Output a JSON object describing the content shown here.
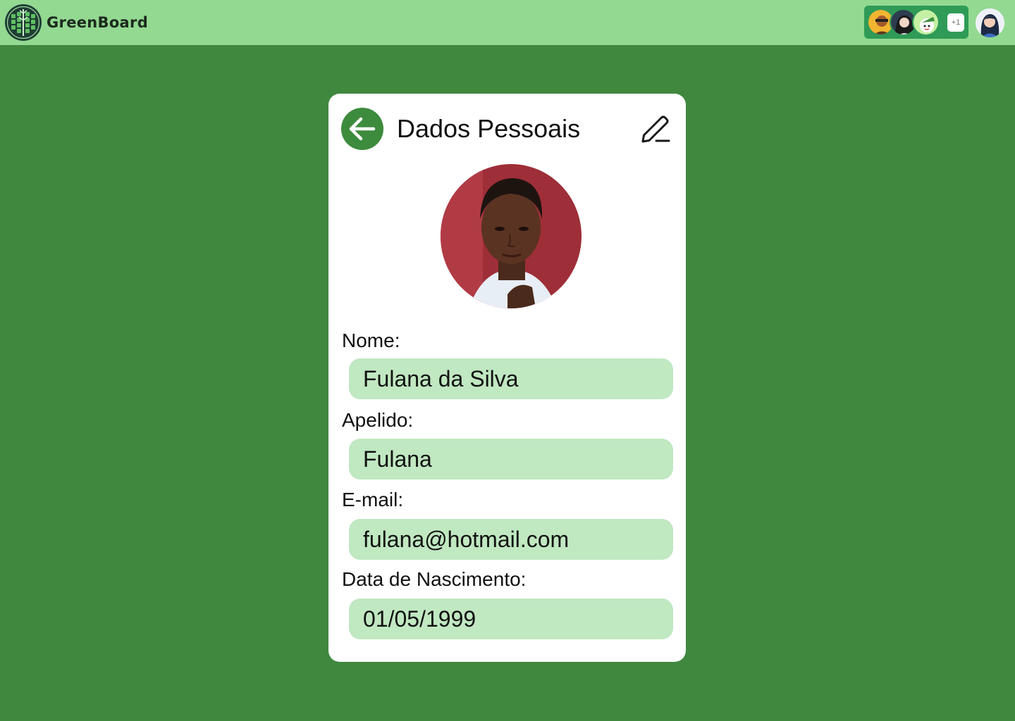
{
  "app": {
    "name": "GreenBoard",
    "logo_icon": "tree-grid-logo-icon"
  },
  "topbar": {
    "collaborators_more": "+1",
    "collaborator_icons": [
      "avatar-1",
      "avatar-2",
      "avatar-3"
    ],
    "user_icon": "user-avatar"
  },
  "card": {
    "title": "Dados Pessoais",
    "back_icon": "arrow-left-icon",
    "edit_icon": "pencil-icon"
  },
  "fields": {
    "name_label": "Nome:",
    "name_value": "Fulana da Silva",
    "nickname_label": "Apelido:",
    "nickname_value": "Fulana",
    "email_label": "E-mail:",
    "email_value": "fulana@hotmail.com",
    "birth_label": "Data de Nascimento:",
    "birth_value": "01/05/1999"
  },
  "colors": {
    "background": "#3f883e",
    "topbar": "#93d991",
    "accent": "#3d8b3d",
    "input_fill": "#c0e8c1",
    "card": "#ffffff"
  }
}
